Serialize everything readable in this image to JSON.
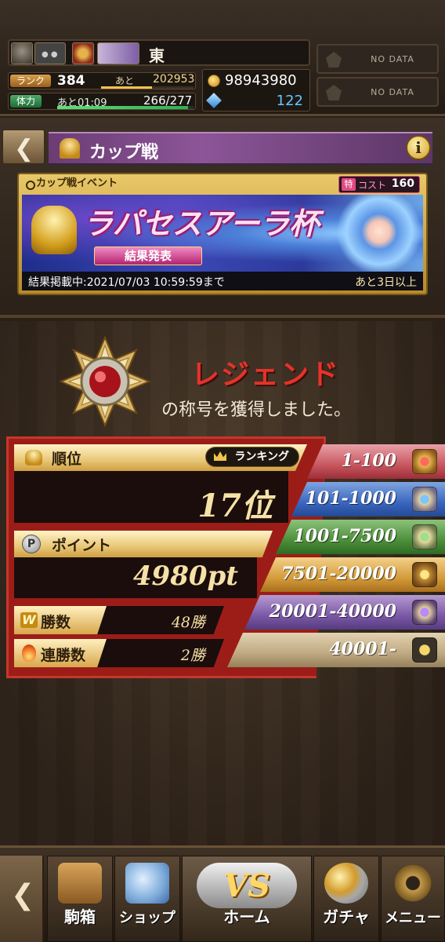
{
  "player": {
    "name": "東",
    "rank_label": "ランク",
    "rank": "384",
    "next_label": "あと",
    "next_value": "202953",
    "rank_progress": 0.55,
    "stamina_label": "体力",
    "stamina_timer": "あと01:09",
    "stamina_value": "266/277",
    "stamina_progress": 0.96,
    "coins": "98943980",
    "gems": "122"
  },
  "side_slots": [
    {
      "label": "NO DATA"
    },
    {
      "label": "NO DATA"
    }
  ],
  "header": {
    "title": "カップ戦",
    "back_icon": "chevron-left-icon",
    "info_icon": "info-icon",
    "info_glyph": "i"
  },
  "event": {
    "tag": "カップ戦イベント",
    "cost_special": "特",
    "cost_label": "コスト",
    "cost_value": "160",
    "title": "ラパセスアーラ杯",
    "ribbon": "結果発表",
    "date_text": "結果掲載中:2021/07/03 10:59:59まで",
    "remaining": "あと3日以上"
  },
  "result": {
    "title": "レジェンド",
    "subtitle": "の称号を獲得しました。",
    "rank_label": "順位",
    "ranking_button": "ランキング",
    "rank_value": "17位",
    "points_label": "ポイント",
    "points_icon_glyph": "P",
    "points_value": "4980pt",
    "wins_label": "勝数",
    "wins_icon_glyph": "W",
    "wins_value": "48勝",
    "streak_label": "連勝数",
    "streak_value": "2勝"
  },
  "tiers": [
    {
      "range": "1-100",
      "color": "#c8575f"
    },
    {
      "range": "101-1000",
      "color": "#3a66bf"
    },
    {
      "range": "1001-7500",
      "color": "#4c8f3a"
    },
    {
      "range": "7501-20000",
      "color": "#d49b3a"
    },
    {
      "range": "20001-40000",
      "color": "#7a58a6"
    },
    {
      "range": "40001-",
      "color": "#bfa982"
    }
  ],
  "nav": {
    "back_glyph": "❮",
    "box": "駒箱",
    "shop": "ショップ",
    "home": "ホーム",
    "home_logo": "VS",
    "gacha": "ガチャ",
    "menu": "メニュー"
  },
  "colors": {
    "legend_red": "#e5332a",
    "gem_blue": "#66c7ff",
    "panel_red": "#9c1d18"
  }
}
